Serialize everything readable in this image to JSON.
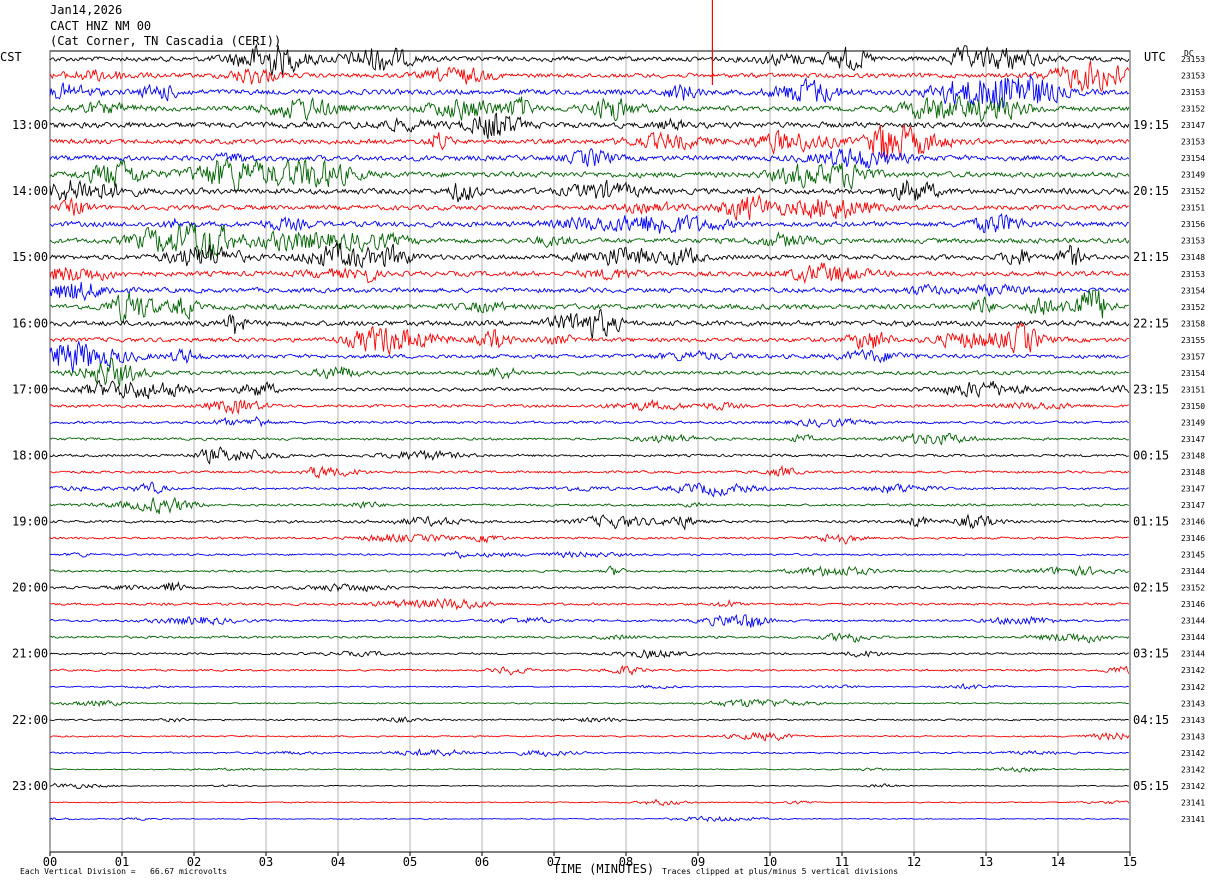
{
  "header": {
    "date": "Jan14,2026",
    "station": "CACT HNZ NM 00",
    "location": "(Cat Corner, TN Cascadia (CERI))"
  },
  "axes": {
    "left_label": "CST",
    "right_label": "UTC",
    "dc_label": "DC",
    "xlabel": "TIME (MINUTES)"
  },
  "footer": {
    "scale_note": "Each Vertical Division =   66.67 microvolts",
    "clip_note": "Traces clipped at plus/minus 5 vertical divisions"
  },
  "colors": {
    "trace_cycle": [
      "#000000",
      "#ff0000",
      "#0000ff",
      "#006400"
    ],
    "grid": "#808080",
    "background": "#ffffff"
  },
  "chart_data": {
    "type": "line",
    "title": "Jan14,2026 CACT HNZ NM 00 (Cat Corner, TN Cascadia (CERI))",
    "xlabel": "TIME (MINUTES)",
    "x_ticks": [
      "00",
      "01",
      "02",
      "03",
      "04",
      "05",
      "06",
      "07",
      "08",
      "09",
      "10",
      "11",
      "12",
      "13",
      "14",
      "15"
    ],
    "xlim": [
      0,
      15
    ],
    "trace_minutes_each": 15,
    "trace_count": 47,
    "left_time_labels": [
      "13:00",
      "14:00",
      "15:00",
      "16:00",
      "17:00",
      "18:00",
      "19:00",
      "20:00",
      "21:00",
      "22:00",
      "23:00"
    ],
    "right_time_labels": [
      "19:15",
      "20:15",
      "21:15",
      "22:15",
      "23:15",
      "00:15",
      "01:15",
      "02:15",
      "03:15",
      "04:15",
      "05:15"
    ],
    "dc_offsets": [
      23153,
      23153,
      23153,
      23152,
      23147,
      23153,
      23154,
      23149,
      23152,
      23151,
      23156,
      23153,
      23148,
      23153,
      23154,
      23152,
      23158,
      23155,
      23157,
      23154,
      23151,
      23150,
      23149,
      23147,
      23148,
      23148,
      23147,
      23147,
      23146,
      23146,
      23145,
      23144,
      23152,
      23146,
      23144,
      23144,
      23144,
      23142,
      23142,
      23143,
      23143,
      23143,
      23142,
      23142,
      23142,
      23141,
      23141
    ],
    "activity": [
      2.6,
      2.4,
      2.8,
      2.7,
      3.0,
      2.6,
      2.8,
      2.9,
      3.0,
      2.6,
      2.8,
      2.7,
      2.7,
      2.6,
      2.5,
      2.8,
      2.8,
      2.3,
      2.1,
      2.0,
      1.7,
      1.5,
      1.4,
      1.3,
      1.3,
      1.3,
      1.2,
      1.2,
      1.4,
      1.2,
      1.0,
      1.1,
      1.3,
      1.3,
      1.2,
      1.2,
      1.0,
      1.0,
      0.6,
      0.7,
      0.8,
      0.8,
      0.8,
      0.6,
      0.5,
      0.6,
      0.5
    ],
    "scale_microvolts_per_division": 66.67,
    "clip_divisions": 5
  }
}
